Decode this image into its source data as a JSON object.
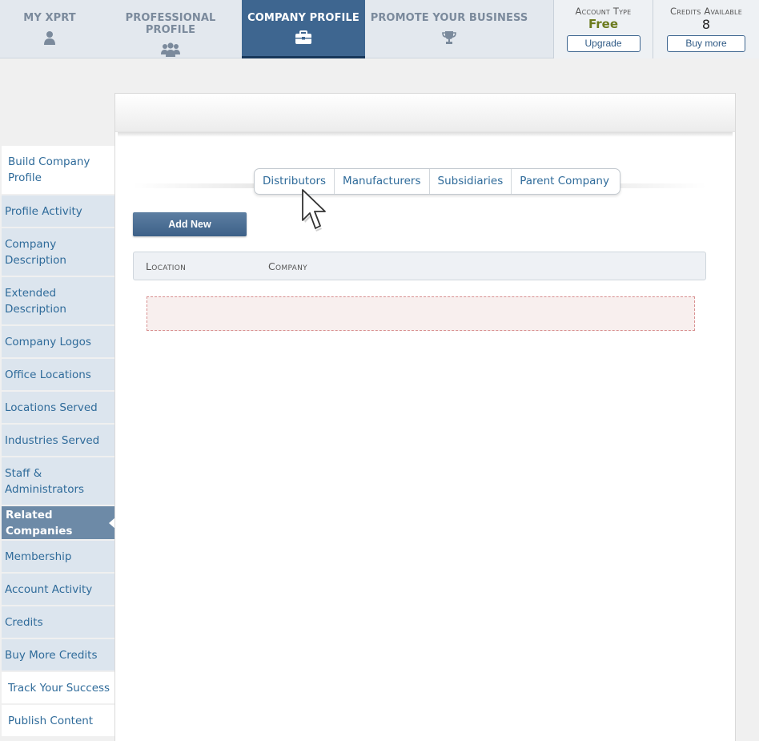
{
  "topnav": {
    "tabs": [
      {
        "label": "MY XPRT",
        "icon": "user-icon"
      },
      {
        "label": "PROFESSIONAL PROFILE",
        "icon": "users-icon"
      },
      {
        "label": "COMPANY PROFILE",
        "icon": "briefcase-icon",
        "active": true
      },
      {
        "label": "PROMOTE YOUR BUSINESS",
        "icon": "trophy-icon"
      }
    ],
    "account_type": {
      "caption": "Account Type",
      "value": "Free",
      "button": "Upgrade"
    },
    "credits": {
      "caption": "Credits Available",
      "value": "8",
      "button": "Buy more"
    }
  },
  "sidebar": {
    "items": [
      {
        "label": "Build Company Profile"
      },
      {
        "label": "Profile Activity"
      },
      {
        "label": "Company Description"
      },
      {
        "label": "Extended Description"
      },
      {
        "label": "Company Logos"
      },
      {
        "label": "Office Locations"
      },
      {
        "label": "Locations Served"
      },
      {
        "label": "Industries Served"
      },
      {
        "label": "Staff & Administrators"
      },
      {
        "label": "Related Companies",
        "active": true
      },
      {
        "label": "Membership"
      },
      {
        "label": "Account Activity"
      },
      {
        "label": "Credits"
      },
      {
        "label": "Buy More Credits"
      },
      {
        "label": "Track Your Success"
      },
      {
        "label": "Publish Content"
      }
    ]
  },
  "main": {
    "subtabs": [
      "Distributors",
      "Manufacturers",
      "Subsidiaries",
      "Parent Company"
    ],
    "add_new_label": "Add New",
    "table_headers": [
      "Location",
      "Company"
    ]
  },
  "colors": {
    "nav_active": "#3e6690",
    "nav_bg": "#e3e8ee",
    "sidebar_bg": "#dce5ee",
    "sidebar_active": "#6d8aa7",
    "free_text": "#6b7a1c",
    "link": "#2f6b9a"
  }
}
